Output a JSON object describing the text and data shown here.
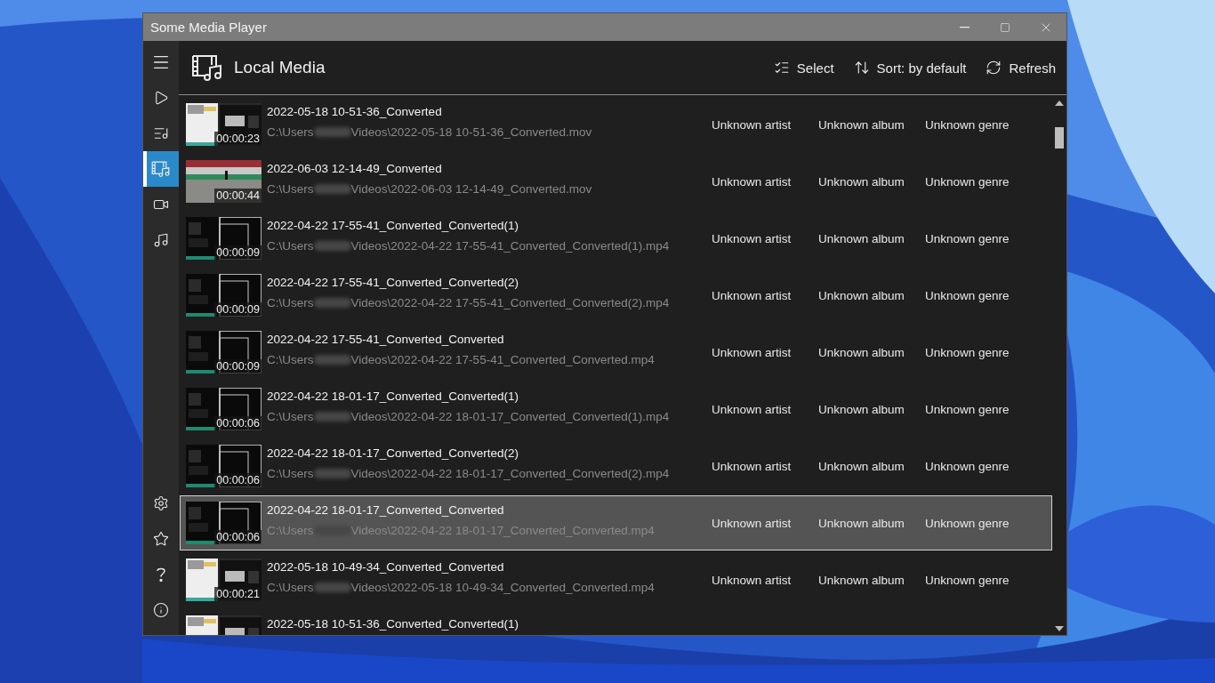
{
  "window": {
    "title": "Some Media Player"
  },
  "nav_top": [
    {
      "kind": "menu",
      "selected": false
    },
    {
      "kind": "play",
      "selected": false
    },
    {
      "kind": "playlist",
      "selected": false
    },
    {
      "kind": "media",
      "selected": true
    },
    {
      "kind": "video",
      "selected": false
    },
    {
      "kind": "music",
      "selected": false
    }
  ],
  "nav_bottom": [
    {
      "kind": "settings",
      "selected": false
    },
    {
      "kind": "star",
      "selected": false
    },
    {
      "kind": "help",
      "selected": false
    },
    {
      "kind": "info",
      "selected": false
    }
  ],
  "header": {
    "title": "Local Media",
    "actions": [
      {
        "kind": "select",
        "label": "Select"
      },
      {
        "kind": "sort",
        "label": "Sort: by default"
      },
      {
        "kind": "refresh",
        "label": "Refresh"
      }
    ]
  },
  "rows": [
    {
      "kind": "light",
      "duration": "00:00:23",
      "title": "2022-05-18 10-51-36_Converted",
      "path_start": "C:\\Users",
      "path_end": "Videos\\2022-05-18 10-51-36_Converted.mov",
      "artist": "Unknown artist",
      "album": "Unknown album",
      "genre": "Unknown genre",
      "selected": false
    },
    {
      "kind": "field",
      "duration": "00:00:44",
      "title": "2022-06-03 12-14-49_Converted",
      "path_start": "C:\\Users",
      "path_end": "Videos\\2022-06-03 12-14-49_Converted.mov",
      "artist": "Unknown artist",
      "album": "Unknown album",
      "genre": "Unknown genre",
      "selected": false
    },
    {
      "kind": "dark",
      "duration": "00:00:09",
      "title": "2022-04-22 17-55-41_Converted_Converted(1)",
      "path_start": "C:\\Users",
      "path_end": "Videos\\2022-04-22 17-55-41_Converted_Converted(1).mp4",
      "artist": "Unknown artist",
      "album": "Unknown album",
      "genre": "Unknown genre",
      "selected": false
    },
    {
      "kind": "dark",
      "duration": "00:00:09",
      "title": "2022-04-22 17-55-41_Converted_Converted(2)",
      "path_start": "C:\\Users",
      "path_end": "Videos\\2022-04-22 17-55-41_Converted_Converted(2).mp4",
      "artist": "Unknown artist",
      "album": "Unknown album",
      "genre": "Unknown genre",
      "selected": false
    },
    {
      "kind": "dark",
      "duration": "00:00:09",
      "title": "2022-04-22 17-55-41_Converted_Converted",
      "path_start": "C:\\Users",
      "path_end": "Videos\\2022-04-22 17-55-41_Converted_Converted.mp4",
      "artist": "Unknown artist",
      "album": "Unknown album",
      "genre": "Unknown genre",
      "selected": false
    },
    {
      "kind": "dark",
      "duration": "00:00:06",
      "title": "2022-04-22 18-01-17_Converted_Converted(1)",
      "path_start": "C:\\Users",
      "path_end": "Videos\\2022-04-22 18-01-17_Converted_Converted(1).mp4",
      "artist": "Unknown artist",
      "album": "Unknown album",
      "genre": "Unknown genre",
      "selected": false
    },
    {
      "kind": "dark",
      "duration": "00:00:06",
      "title": "2022-04-22 18-01-17_Converted_Converted(2)",
      "path_start": "C:\\Users",
      "path_end": "Videos\\2022-04-22 18-01-17_Converted_Converted(2).mp4",
      "artist": "Unknown artist",
      "album": "Unknown album",
      "genre": "Unknown genre",
      "selected": false
    },
    {
      "kind": "dark",
      "duration": "00:00:06",
      "title": "2022-04-22 18-01-17_Converted_Converted",
      "path_start": "C:\\Users",
      "path_end": "Videos\\2022-04-22 18-01-17_Converted_Converted.mp4",
      "artist": "Unknown artist",
      "album": "Unknown album",
      "genre": "Unknown genre",
      "selected": true
    },
    {
      "kind": "light",
      "duration": "00:00:21",
      "title": "2022-05-18 10-49-34_Converted_Converted",
      "path_start": "C:\\Users",
      "path_end": "Videos\\2022-05-18 10-49-34_Converted_Converted.mp4",
      "artist": "Unknown artist",
      "album": "Unknown album",
      "genre": "Unknown genre",
      "selected": false
    },
    {
      "kind": "light",
      "title": "2022-05-18 10-51-36_Converted_Converted(1)",
      "selected": false
    }
  ]
}
